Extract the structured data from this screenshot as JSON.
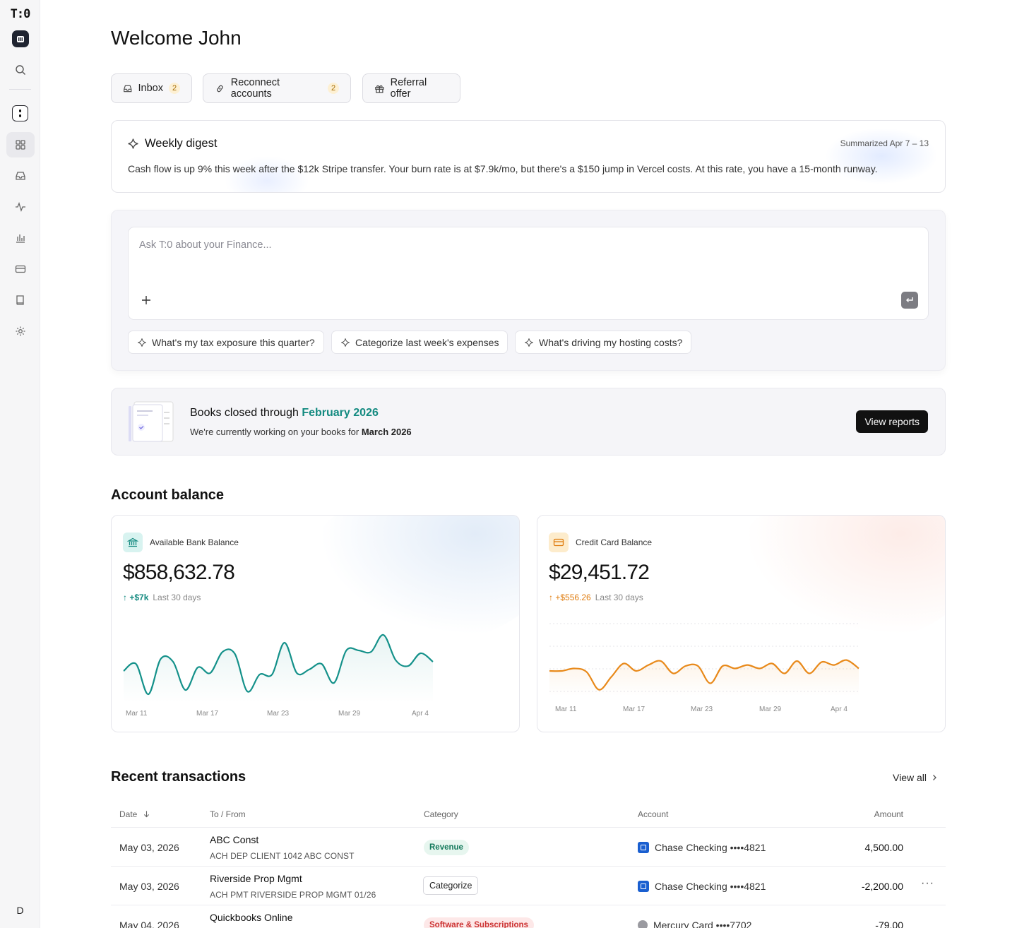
{
  "sidebar": {
    "logo": "T:0",
    "avatar": "D",
    "nav": [
      {
        "icon": "search-icon"
      },
      {
        "icon": "dashboard-icon",
        "active": true
      },
      {
        "icon": "inbox-icon"
      },
      {
        "icon": "activity-icon"
      },
      {
        "icon": "reports-icon"
      },
      {
        "icon": "card-icon"
      },
      {
        "icon": "book-icon"
      },
      {
        "icon": "settings-icon"
      }
    ]
  },
  "header": {
    "title": "Welcome John"
  },
  "quick_actions": [
    {
      "label": "Inbox",
      "count": "2",
      "icon": "inbox-icon"
    },
    {
      "label": "Reconnect accounts",
      "count": "2",
      "icon": "link-icon"
    },
    {
      "label": "Referral offer",
      "icon": "gift-icon"
    }
  ],
  "digest": {
    "title": "Weekly digest",
    "date_range": "Summarized Apr 7 – 13",
    "text": "Cash flow is up 9% this week after the $12k Stripe transfer. Your burn rate is at $7.9k/mo, but there's a $150 jump in Vercel costs. At this rate, you have a 15-month runway."
  },
  "ask": {
    "placeholder": "Ask T:0 about your Finance...",
    "suggestions": [
      "What's my tax exposure this quarter?",
      "Categorize last week's expenses",
      "What's driving my hosting costs?"
    ]
  },
  "books": {
    "title_prefix": "Books closed through ",
    "title_month": "February 2026",
    "sub_prefix": "We're currently working on your books for ",
    "sub_month": "March 2026",
    "button": "View reports"
  },
  "account_balance": {
    "title": "Account balance",
    "cards": [
      {
        "label": "Available Bank Balance",
        "amount": "$858,632.78",
        "delta": "↑ +$7k",
        "period": "Last 30 days",
        "color": "#14918a",
        "x_labels": [
          "Mar 11",
          "Mar 17",
          "Mar 23",
          "Mar 29",
          "Apr 4"
        ]
      },
      {
        "label": "Credit Card Balance",
        "amount": "$29,451.72",
        "delta": "↑ +$556.26",
        "period": "Last 30 days",
        "color": "#e8891a",
        "x_labels": [
          "Mar 11",
          "Mar 17",
          "Mar 23",
          "Mar 29",
          "Apr 4"
        ]
      }
    ]
  },
  "chart_data": [
    {
      "type": "area",
      "title": "Available Bank Balance",
      "x": [
        "Mar 11",
        "Mar 12",
        "Mar 13",
        "Mar 14",
        "Mar 15",
        "Mar 16",
        "Mar 17",
        "Mar 18",
        "Mar 19",
        "Mar 20",
        "Mar 21",
        "Mar 22",
        "Mar 23",
        "Mar 24",
        "Mar 25",
        "Mar 26",
        "Mar 27",
        "Mar 28",
        "Mar 29",
        "Mar 30",
        "Mar 31",
        "Apr 1",
        "Apr 2",
        "Apr 3",
        "Apr 4",
        "Apr 5",
        "Apr 6"
      ],
      "values": [
        0.45,
        0.55,
        0.12,
        0.62,
        0.58,
        0.18,
        0.5,
        0.42,
        0.72,
        0.69,
        0.16,
        0.4,
        0.4,
        0.85,
        0.42,
        0.47,
        0.55,
        0.28,
        0.74,
        0.74,
        0.72,
        0.96,
        0.6,
        0.52,
        0.7,
        0.58
      ],
      "categories_labeled": [
        "Mar 11",
        "Mar 17",
        "Mar 23",
        "Mar 29",
        "Apr 4"
      ]
    },
    {
      "type": "area",
      "title": "Credit Card Balance",
      "values": [
        0.5,
        0.5,
        0.55,
        0.48,
        0.12,
        0.38,
        0.65,
        0.5,
        0.62,
        0.7,
        0.45,
        0.6,
        0.6,
        0.25,
        0.6,
        0.55,
        0.62,
        0.55,
        0.65,
        0.45,
        0.7,
        0.45,
        0.68,
        0.62,
        0.72,
        0.55
      ],
      "categories_labeled": [
        "Mar 11",
        "Mar 17",
        "Mar 23",
        "Mar 29",
        "Apr 4"
      ]
    }
  ],
  "transactions": {
    "title": "Recent transactions",
    "view_all": "View all",
    "columns": [
      "Date",
      "To / From",
      "Category",
      "Account",
      "Amount"
    ],
    "rows": [
      {
        "date": "May 03, 2026",
        "name": "ABC Const",
        "memo": "ACH DEP CLIENT 1042 ABC CONST",
        "category": "Revenue",
        "category_kind": "tag-rev",
        "account": "Chase Checking ••••4821",
        "amount": "4,500.00"
      },
      {
        "date": "May 03, 2026",
        "name": "Riverside Prop Mgmt",
        "memo": "ACH PMT RIVERSIDE PROP MGMT 01/26",
        "category": "Categorize",
        "category_kind": "button",
        "account": "Chase Checking ••••4821",
        "amount": "-2,200.00",
        "more": "···"
      },
      {
        "date": "May 04, 2026",
        "name": "Quickbooks Online",
        "memo": "",
        "category": "Software & Subscriptions",
        "category_kind": "tag-sw",
        "account": "Mercury Card ••••7702",
        "amount": "-79.00"
      }
    ]
  }
}
